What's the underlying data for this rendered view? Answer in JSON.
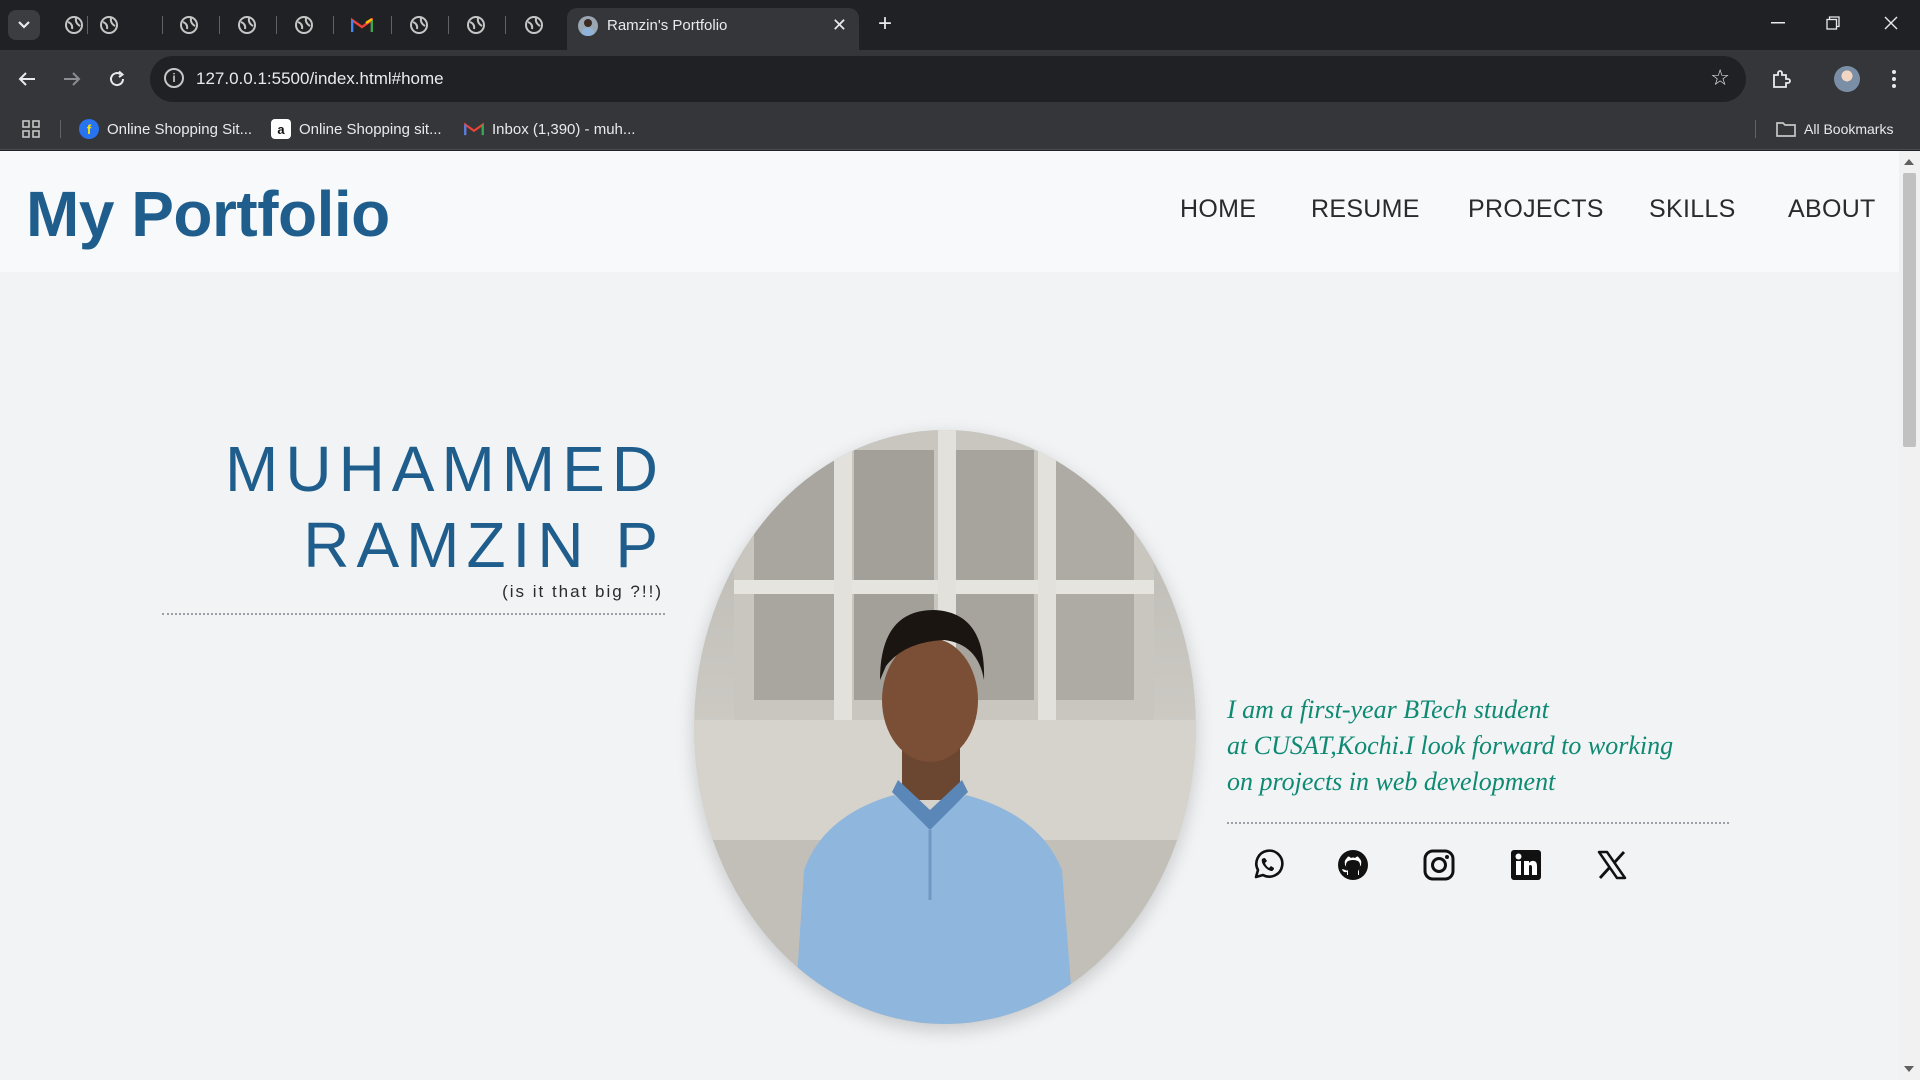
{
  "browser": {
    "active_tab_title": "Ramzin's Portfolio",
    "url": "127.0.0.1:5500/index.html#home",
    "bookmarks": [
      {
        "label": "Online Shopping Sit...",
        "icon": "flipkart-icon"
      },
      {
        "label": "Online Shopping sit...",
        "icon": "amazon-icon"
      },
      {
        "label": "Inbox (1,390) - muh...",
        "icon": "gmail-icon"
      }
    ],
    "all_bookmarks_label": "All Bookmarks"
  },
  "site": {
    "logo": "My Portfolio",
    "nav": [
      "HOME",
      "RESUME",
      "PROJECTS",
      "SKILLS",
      "ABOUT"
    ]
  },
  "hero": {
    "name_line1": "MUHAMMED",
    "name_line2": "RAMZIN P",
    "subtitle": "(is it that big ?!!)",
    "bio_line1": "I am a first-year BTech student",
    "bio_line2": "at CUSAT,Kochi.I look forward to working",
    "bio_line3": "on projects in web development",
    "social": [
      "whatsapp-icon",
      "github-icon",
      "instagram-icon",
      "linkedin-icon",
      "x-icon"
    ]
  },
  "colors": {
    "brand_blue": "#1f5e8c",
    "bio_green": "#0e8a73",
    "page_bg": "#f1f3f5"
  }
}
